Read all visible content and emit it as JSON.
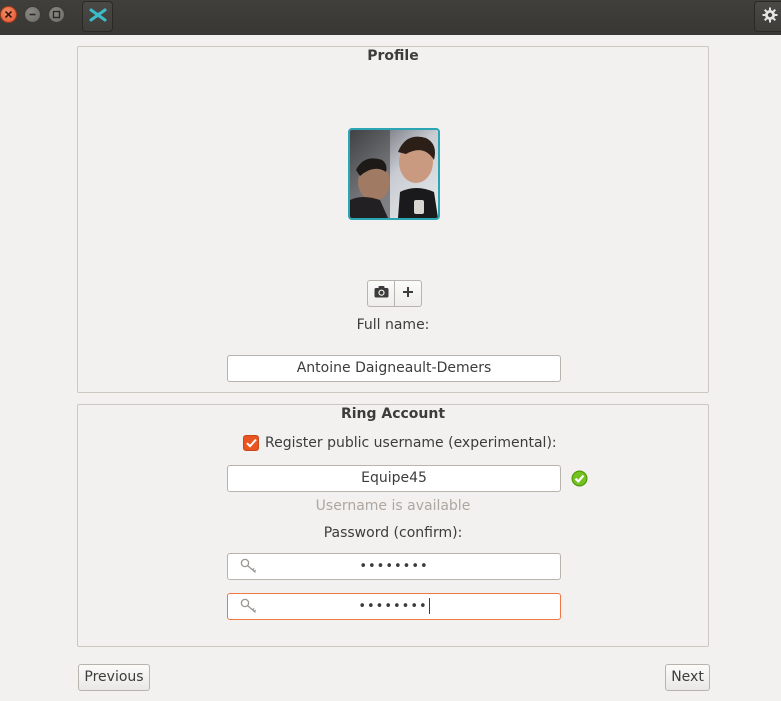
{
  "window": {
    "close_icon": "close-icon",
    "minimize_icon": "minimize-icon",
    "maximize_icon": "maximize-icon",
    "app_icon": "ring-logo-icon",
    "settings_icon": "gear-icon"
  },
  "profile": {
    "title": "Profile",
    "avatar_icon": "profile-photo",
    "take_photo_icon": "camera-icon",
    "choose_photo_icon": "plus-icon",
    "full_name_label": "Full name:",
    "full_name_value": "Antoine Daigneault-Demers"
  },
  "ring_account": {
    "title": "Ring Account",
    "register_checked": true,
    "register_label": "Register public username (experimental):",
    "username_value": "Equipe45",
    "username_status_icon": "check-circle-icon",
    "username_hint": "Username is available",
    "password_label": "Password (confirm):",
    "password_value": "••••••••",
    "password_confirm_value": "••••••••",
    "key_icon": "key-icon"
  },
  "nav": {
    "previous_label": "Previous",
    "next_label": "Next"
  },
  "colors": {
    "accent": "#e95420",
    "avatar_border": "#2ba4b3",
    "success": "#4e9a06",
    "hint": "#aea79f"
  }
}
